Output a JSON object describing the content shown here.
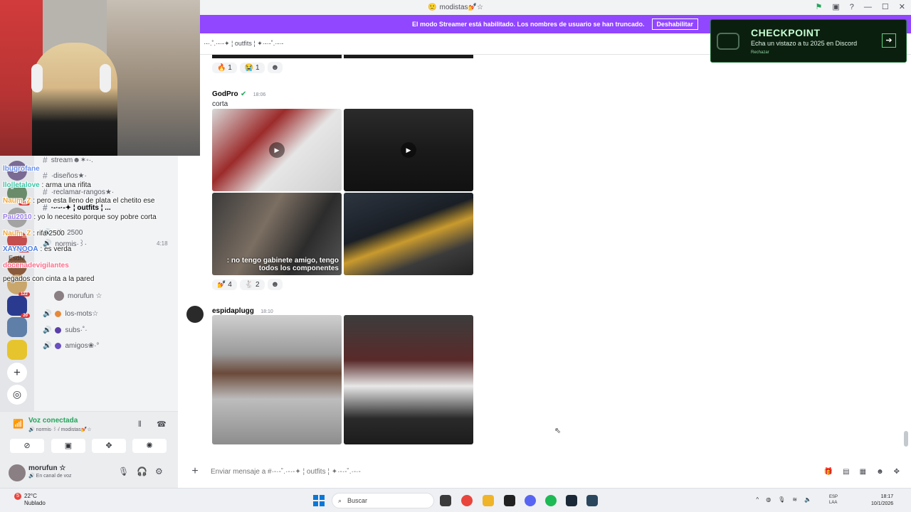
{
  "titlebar": {
    "title": "modistas💅☆",
    "icons": [
      "flag-icon",
      "monitor-icon",
      "help-icon"
    ]
  },
  "streamer_banner": {
    "text": "El modo Streamer está habilitado. Los nombres de usuario se han truncado.",
    "button": "Deshabilitar"
  },
  "channel_header": {
    "name": "·-·.˚.·-·-✦ ¦ outfits ¦ ✦·-·-˚.·-·-"
  },
  "servers": [
    {
      "badge": "115"
    },
    {
      "badge": ""
    },
    {
      "badge": "238"
    },
    {
      "badge": ""
    },
    {
      "badge": "122"
    },
    {
      "badge": "20"
    },
    {
      "badge": ""
    },
    {
      "badge": ""
    }
  ],
  "channels": [
    {
      "icon": "#",
      "label": "stream☻✶◦·."
    },
    {
      "icon": "#",
      "label": "·diseños★·"
    },
    {
      "icon": "#",
      "label": "·reclamar-rangos★·"
    },
    {
      "icon": "#",
      "label": "·-·-·-✦ ¦ outfits ¦ ..."
    },
    {
      "icon": "🔊",
      "label": "rifa 2500"
    },
    {
      "icon": "🔊",
      "label": "normis·꒱·"
    },
    {
      "icon": "",
      "label": "EsdM"
    },
    {
      "icon": "",
      "label": "morufun ☆"
    },
    {
      "icon": "🔊",
      "label": "los-mots☆"
    },
    {
      "icon": "🔊",
      "label": "subs·˚·"
    },
    {
      "icon": "🔊",
      "label": "amigos❀·°"
    }
  ],
  "voice_panel": {
    "status": "Voz conectada",
    "channel": "🔊 normis·꒱·/ modistas💅☆",
    "timer": "4:18"
  },
  "user_panel": {
    "name": "morufun ☆",
    "status": "🔊 En canal de voz"
  },
  "messages": [
    {
      "author": "GodPro",
      "time": "18:06",
      "text": "corta",
      "reactions": [
        {
          "emoji": "🔥",
          "count": "1"
        },
        {
          "emoji": "😭",
          "count": "1"
        }
      ],
      "reactions_prev": [
        {
          "emoji": "🔥",
          "count": "1"
        },
        {
          "emoji": "😭",
          "count": "1"
        }
      ],
      "reactions_after": [
        {
          "emoji": "💅",
          "count": "4"
        },
        {
          "emoji": "🐇",
          "count": "2"
        }
      ]
    },
    {
      "author": "espidaplugg",
      "time": "18:10",
      "text": ""
    }
  ],
  "composer": {
    "placeholder": "Enviar mensaje a #·-·-˚.·-·-✦ ¦ outfits ¦ ✦·-·-˚.·-·-"
  },
  "checkpoint": {
    "title": "CHECKPOINT",
    "subtitle": "Echa un vistazo a tu 2025 en Discord",
    "dismiss": "Rechazar"
  },
  "overlay_chat": [
    {
      "user": "lbugrofane",
      "text": ""
    },
    {
      "user": "llo|letalove",
      "text": ": arma una rifita"
    },
    {
      "user": "Naum_Z",
      "text": ": pero esta lleno de plata el chetito ese"
    },
    {
      "user": "Pau2010",
      "text": ": yo lo necesito porque soy pobre corta"
    },
    {
      "user": "Naum_Z",
      "text": ": rifa 2500"
    },
    {
      "user": "XAYNOOA",
      "text": ": es verda"
    },
    {
      "user": "docenadevigilantes",
      "text": ": no tengo gabinete amigo, tengo todos los componentes"
    },
    {
      "user": "pegados con cinta a la pared",
      "text": ""
    }
  ],
  "taskbar": {
    "weather_temp": "22°C",
    "weather_desc": "Nublado",
    "weather_badge": "5",
    "search": "Buscar",
    "lang1": "ESP",
    "lang2": "LAA",
    "time": "18:17",
    "date": "10/1/2026"
  },
  "colors": {
    "accent": "#9146ff",
    "online": "#23a55a",
    "checkpoint_bg": "#0b1f0f"
  }
}
